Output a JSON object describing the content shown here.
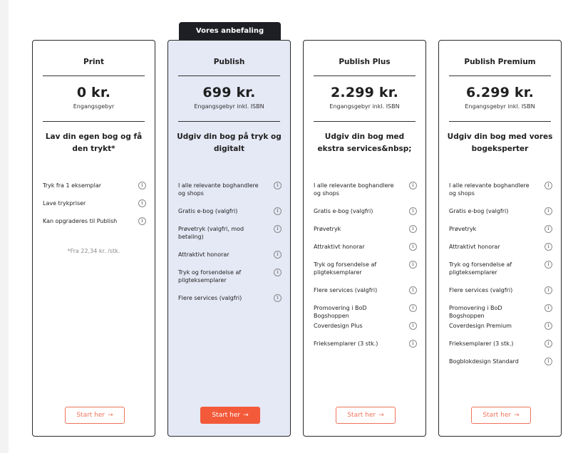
{
  "recommendation_label": "Vores anbefaling",
  "plans": [
    {
      "name": "Print",
      "price": "0 kr.",
      "fee_label": "Engangsgebyr",
      "tagline": "Lav din egen bog og få den trykt*",
      "features": [
        "Tryk fra 1 eksemplar",
        "Lave trykpriser",
        "Kan opgraderes til Publish"
      ],
      "footnote": "*Fra 22,34 kr. /stk.",
      "cta_label": "Start her",
      "cta_icon": "arrow-right-icon"
    },
    {
      "name": "Publish",
      "price": "699 kr.",
      "fee_label": "Engangsgebyr inkl. ISBN",
      "tagline": "Udgiv din bog på tryk og digitalt",
      "features": [
        "I alle relevante boghandlere og shops",
        "Gratis e-bog (valgfri)",
        "Prøvetryk (valgfri, mod betaling)",
        "Attraktivt honorar",
        "Tryk og forsendelse af pligteksemplarer",
        "Flere services (valgfri)"
      ],
      "cta_label": "Start her",
      "cta_icon": "arrow-right-icon"
    },
    {
      "name": "Publish Plus",
      "price": "2.299 kr.",
      "fee_label": "Engangsgebyr inkl. ISBN",
      "tagline": "Udgiv din bog med ekstra services&nbsp;",
      "features": [
        "I alle relevante boghandlere og shops",
        "Gratis e-bog (valgfri)",
        "Prøvetryk",
        "Attraktivt honorar",
        "Tryk og forsendelse af pligteksemplarer",
        "Flere services (valgfri)",
        "Promovering i BoD Bogshoppen",
        "Coverdesign Plus",
        "Frieksemplarer (3 stk.)"
      ],
      "cta_label": "Start her",
      "cta_icon": "arrow-right-icon"
    },
    {
      "name": "Publish Premium",
      "price": "6.299 kr.",
      "fee_label": "Engangsgebyr inkl. ISBN",
      "tagline": "Udgiv din bog med vores bogeksperter",
      "features": [
        "I alle relevante boghandlere og shops",
        "Gratis e-bog (valgfri)",
        "Prøvetryk",
        "Attraktivt honorar",
        "Tryk og forsendelse af pligteksemplarer",
        "Flere services (valgfri)",
        "Promovering i BoD Bogshoppen",
        "Coverdesign Premium",
        "Frieksemplarer (3 stk.)",
        "Bogblokdesign Standard"
      ],
      "cta_label": "Start her",
      "cta_icon": "arrow-right-icon"
    }
  ],
  "info_icon": "info-circle-icon",
  "colors": {
    "accent": "#f35a3a",
    "featured_bg": "#e5e8f5",
    "ribbon_bg": "#1e1f25",
    "border": "#2b2b2b"
  }
}
